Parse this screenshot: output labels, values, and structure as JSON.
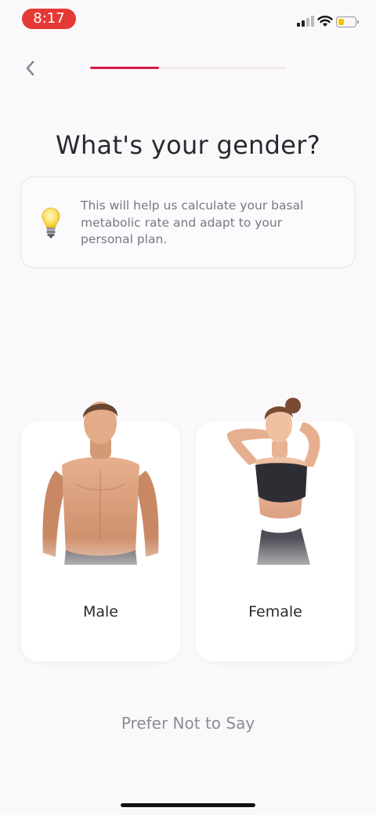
{
  "status_bar": {
    "time": "8:17",
    "icons": [
      "cellular-signal-icon",
      "wifi-icon",
      "battery-icon"
    ],
    "battery_level": 0.35
  },
  "nav": {
    "back_icon": "chevron-left-icon",
    "progress": 0.35
  },
  "page": {
    "title": "What's your gender?"
  },
  "info": {
    "icon": "lightbulb-icon",
    "text": "This will help us calculate your basal metabolic rate and adapt to your personal plan."
  },
  "options": [
    {
      "label": "Male"
    },
    {
      "label": "Female"
    }
  ],
  "prefer_not": "Prefer Not to Say",
  "colors": {
    "accent": "#d81b45",
    "time_pill": "#e53935",
    "background": "#faf8fb"
  }
}
